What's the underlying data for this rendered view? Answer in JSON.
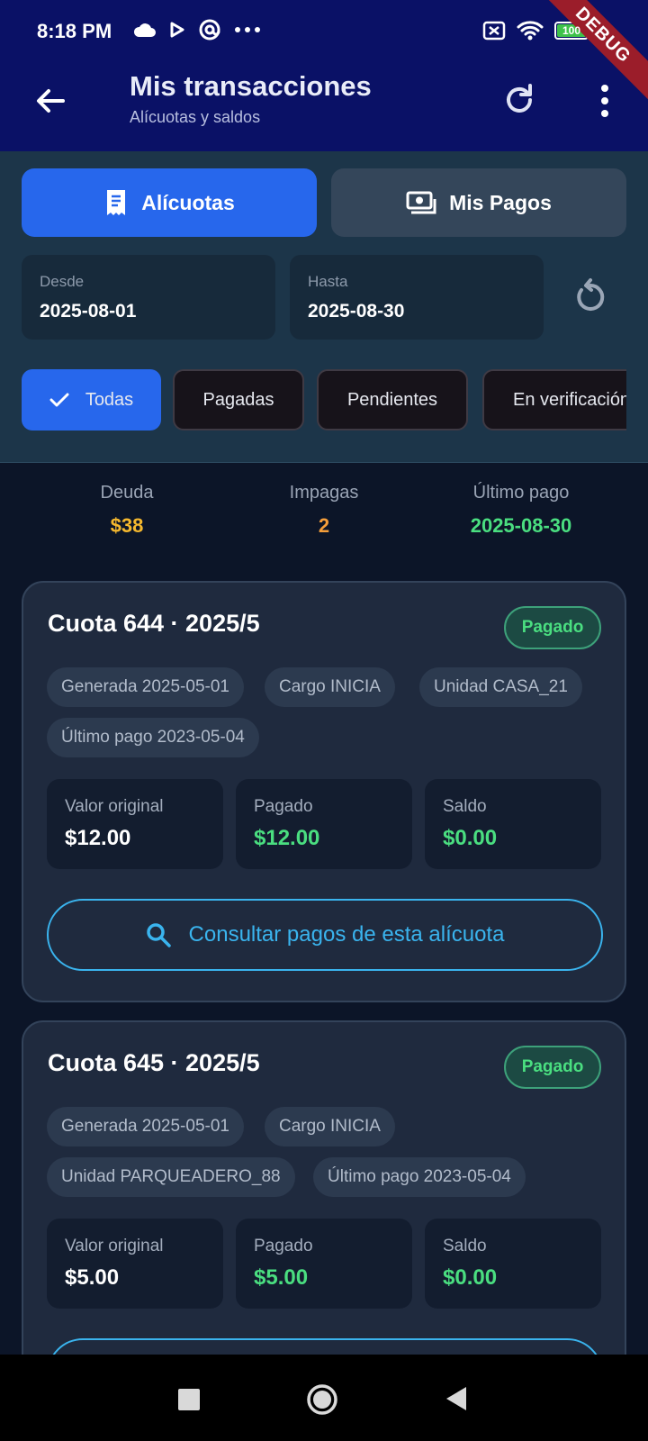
{
  "status_bar": {
    "time": "8:18 PM",
    "battery": "100",
    "debug_banner": "DEBUG",
    "left_icons": [
      "cloud-icon",
      "play-icon",
      "at-icon",
      "more-dots-icon"
    ],
    "right_icons": [
      "no-sim-icon",
      "wifi-icon",
      "battery-icon",
      "bolt-icon"
    ]
  },
  "app_bar": {
    "title": "Mis transacciones",
    "subtitle": "Alícuotas y saldos",
    "icons": [
      "back-arrow-icon",
      "refresh-icon",
      "more-vert-icon"
    ]
  },
  "segments": [
    {
      "label": "Alícuotas",
      "icon": "receipt-icon",
      "active": true
    },
    {
      "label": "Mis Pagos",
      "icon": "money-icon",
      "active": false
    }
  ],
  "date_range": {
    "from_label": "Desde",
    "from_value": "2025-08-01",
    "to_label": "Hasta",
    "to_value": "2025-08-30",
    "reset_icon": "restart-icon"
  },
  "filters": [
    {
      "label": "Todas",
      "selected": true
    },
    {
      "label": "Pagadas",
      "selected": false
    },
    {
      "label": "Pendientes",
      "selected": false
    },
    {
      "label": "En verificación",
      "selected": false
    }
  ],
  "summary": {
    "debt_label": "Deuda",
    "debt_value": "$38",
    "unpaid_label": "Impagas",
    "unpaid_value": "2",
    "last_payment_label": "Último pago",
    "last_payment_value": "2025-08-30"
  },
  "cards": [
    {
      "title": "Cuota 644 · 2025/5",
      "status": "Pagado",
      "tags": [
        "Generada 2025-05-01",
        "Cargo INICIA",
        "Unidad CASA_21",
        "Último pago 2023-05-04"
      ],
      "original_label": "Valor original",
      "original_value": "$12.00",
      "paid_label": "Pagado",
      "paid_value": "$12.00",
      "balance_label": "Saldo",
      "balance_value": "$0.00",
      "consult_label": "Consultar pagos de esta alícuota"
    },
    {
      "title": "Cuota 645 · 2025/5",
      "status": "Pagado",
      "tags": [
        "Generada 2025-05-01",
        "Cargo INICIA",
        "Unidad PARQUEADERO_88",
        "Último pago 2023-05-04"
      ],
      "original_label": "Valor original",
      "original_value": "$5.00",
      "paid_label": "Pagado",
      "paid_value": "$5.00",
      "balance_label": "Saldo",
      "balance_value": "$0.00"
    }
  ],
  "colors": {
    "app_bar": "#0a1166",
    "accent": "#2767ec",
    "debt": "#f5b82e",
    "unpaid": "#f59e3a",
    "success": "#4ade80",
    "link": "#3ab4ee"
  }
}
